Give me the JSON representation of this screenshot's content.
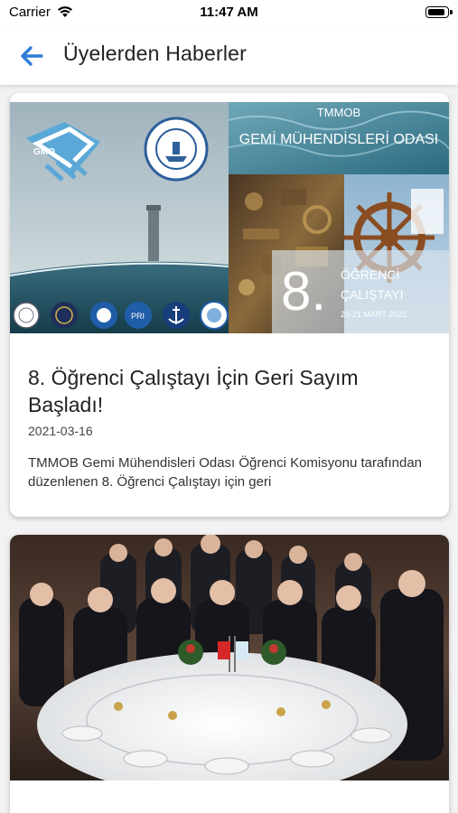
{
  "status_bar": {
    "carrier": "Carrier",
    "time": "11:47 AM",
    "battery_level": 0.95,
    "icons": [
      "wifi-icon",
      "battery-icon"
    ]
  },
  "nav": {
    "title": "Üyelerden Haberler",
    "back_icon": "arrow-left-icon",
    "accent_color": "#2f7cd8"
  },
  "news": [
    {
      "banner": {
        "org": "TMMOB",
        "chamber": "GEMİ MÜHENDİSLERİ ODASI",
        "logo_text": "GMO",
        "number": "8.",
        "event_line1": "ÖĞRENCİ",
        "event_line2": "ÇALIŞTAYI",
        "event_dates": "20-21 MART 2021"
      },
      "title": "8. Öğrenci Çalıştayı İçin Geri Sayım Başladı!",
      "date": "2021-03-16",
      "excerpt": "TMMOB Gemi Mühendisleri Odası Öğrenci Komisyonu tarafından düzenlenen 8. Öğrenci Çalıştayı için geri"
    },
    {
      "image_description_icon": "banquet-photo"
    }
  ]
}
